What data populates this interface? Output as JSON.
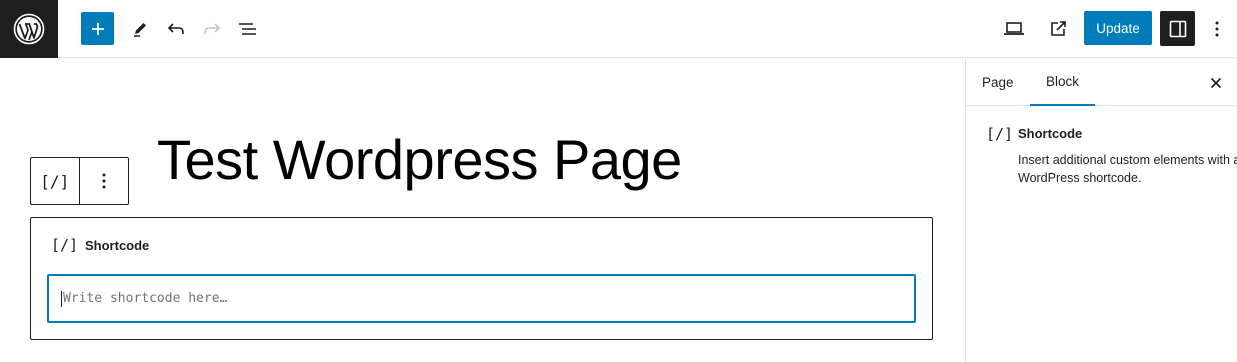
{
  "topbar": {
    "logo_icon": "wordpress-logo-icon",
    "add_icon": "plus-icon",
    "tools_icon": "pencil-icon",
    "undo_icon": "undo-icon",
    "redo_icon": "redo-icon",
    "outline_icon": "list-view-icon",
    "preview_icon": "laptop-icon",
    "view_icon": "external-link-icon",
    "update_label": "Update",
    "settings_icon": "sidebar-toggle-icon",
    "options_icon": "more-vertical-icon",
    "accent_color": "#007cba"
  },
  "editor": {
    "page_title": "Test Wordpress Page",
    "block_toolbar": {
      "block_icon_text": "[/]",
      "options_icon": "more-vertical-icon"
    },
    "shortcode_block": {
      "icon_text": "[/]",
      "label": "Shortcode",
      "input_placeholder": "Write shortcode here…"
    }
  },
  "sidebar": {
    "tabs": [
      {
        "label": "Page",
        "active": false
      },
      {
        "label": "Block",
        "active": true
      }
    ],
    "close_icon": "close-icon",
    "block_info": {
      "icon_text": "[/]",
      "title": "Shortcode",
      "description": "Insert additional custom elements with a WordPress shortcode."
    }
  }
}
